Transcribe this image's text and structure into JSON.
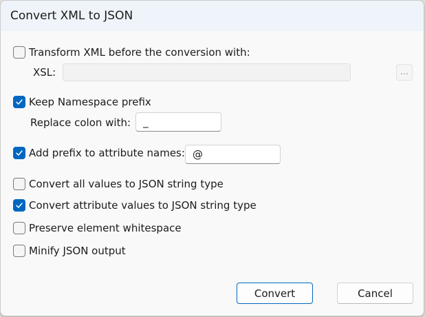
{
  "dialog": {
    "title": "Convert XML to JSON"
  },
  "options": {
    "transform_label": "Transform XML before the conversion with:",
    "transform_checked": false,
    "xsl_label": "XSL:",
    "xsl_value": "",
    "browse_label": "...",
    "keep_ns_label": "Keep Namespace prefix",
    "keep_ns_checked": true,
    "replace_colon_label": "Replace colon with:",
    "replace_colon_value": "_",
    "add_prefix_label": "Add prefix to attribute names:",
    "add_prefix_checked": true,
    "add_prefix_value": "@",
    "all_string_label": "Convert all values to JSON string type",
    "all_string_checked": false,
    "attr_string_label": "Convert attribute values to JSON string type",
    "attr_string_checked": true,
    "whitespace_label": "Preserve element whitespace",
    "whitespace_checked": false,
    "minify_label": "Minify JSON output",
    "minify_checked": false
  },
  "buttons": {
    "convert_label": "Convert",
    "cancel_label": "Cancel"
  },
  "colors": {
    "accent": "#0067c0",
    "titlebar": "#eef4f9",
    "dialog_bg": "#f9f9f9"
  }
}
